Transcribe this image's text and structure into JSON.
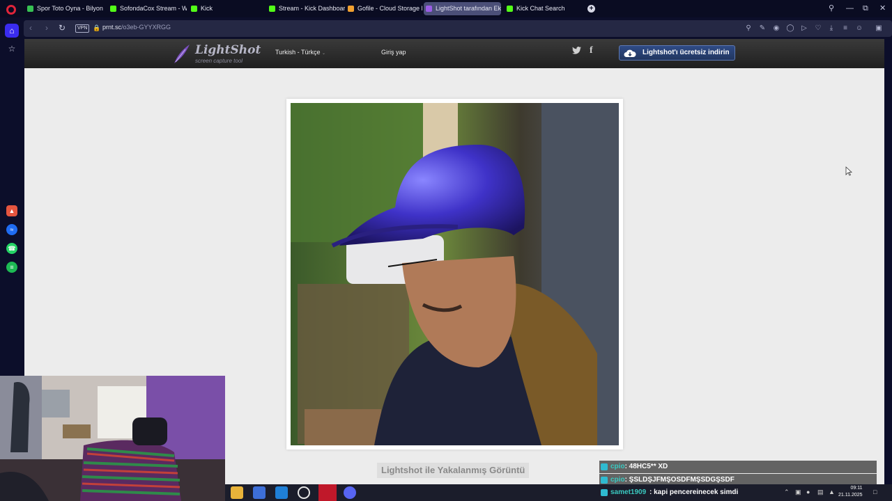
{
  "browser": {
    "tabs": [
      {
        "label": "Spor Toto Oyna - Bilyoner",
        "color": "#37c153"
      },
      {
        "label": "SofondaCox Stream - Wat",
        "color": "#53fc18"
      },
      {
        "label": "Kick",
        "color": "#53fc18"
      },
      {
        "label": "Stream - Kick Dashboard",
        "color": "#53fc18"
      },
      {
        "label": "Gofile - Cloud Storage Ma",
        "color": "#f0a030"
      },
      {
        "label": "LightShot tarafından Ekra",
        "color": "#9b5de5"
      },
      {
        "label": "Kick Chat Search",
        "color": "#53fc18"
      }
    ],
    "active_tab": 5,
    "vpn_label": "VPN",
    "url_host": "prnt.sc",
    "url_path": "/o3eb-GYYXRGG"
  },
  "site": {
    "logo_title": "LightShot",
    "logo_subtitle": "screen capture tool",
    "language": "Turkish - Türkçe",
    "login": "Giriş yap",
    "download_button": "Lightshot'ı ücretsiz indirin",
    "caption": "Lightshot ile Yakalanmış Görüntü"
  },
  "chat": {
    "messages": [
      {
        "user": "cpio",
        "text": ": 48HC5** XD"
      },
      {
        "user": "cpio",
        "text": ": ŞSLDŞJFMŞOSDFMŞSDGŞSDF"
      },
      {
        "user": "samet1909",
        "text": ": kapi pencereinecek simdi"
      }
    ]
  },
  "taskbar": {
    "time": "09:11",
    "date": "21.11.2025"
  }
}
